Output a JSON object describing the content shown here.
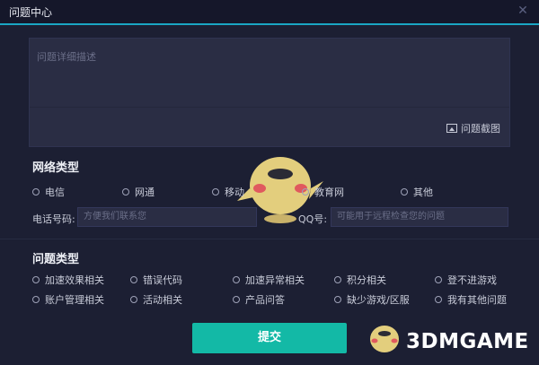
{
  "window": {
    "title": "问题中心",
    "close_icon": "close-icon"
  },
  "description": {
    "placeholder": "问题详细描述",
    "screenshot_label": "问题截图"
  },
  "network": {
    "title": "网络类型",
    "options": [
      "电信",
      "网通",
      "移动",
      "教育网",
      "其他"
    ]
  },
  "contact": {
    "phone_label": "电话号码:",
    "phone_placeholder": "方便我们联系您",
    "qq_label": "QQ号:",
    "qq_placeholder": "可能用于远程检查您的问题"
  },
  "problem": {
    "title": "问题类型",
    "row1": [
      "加速效果相关",
      "错误代码",
      "加速异常相关",
      "积分相关",
      "登不进游戏"
    ],
    "row2": [
      "账户管理相关",
      "活动相关",
      "产品问答",
      "缺少游戏/区服",
      "我有其他问题"
    ]
  },
  "submit_label": "提交",
  "watermark": "3DMGAME",
  "colors": {
    "accent": "#13b9a6",
    "title_line": "#1aa6c4",
    "background": "#1c1f33"
  }
}
